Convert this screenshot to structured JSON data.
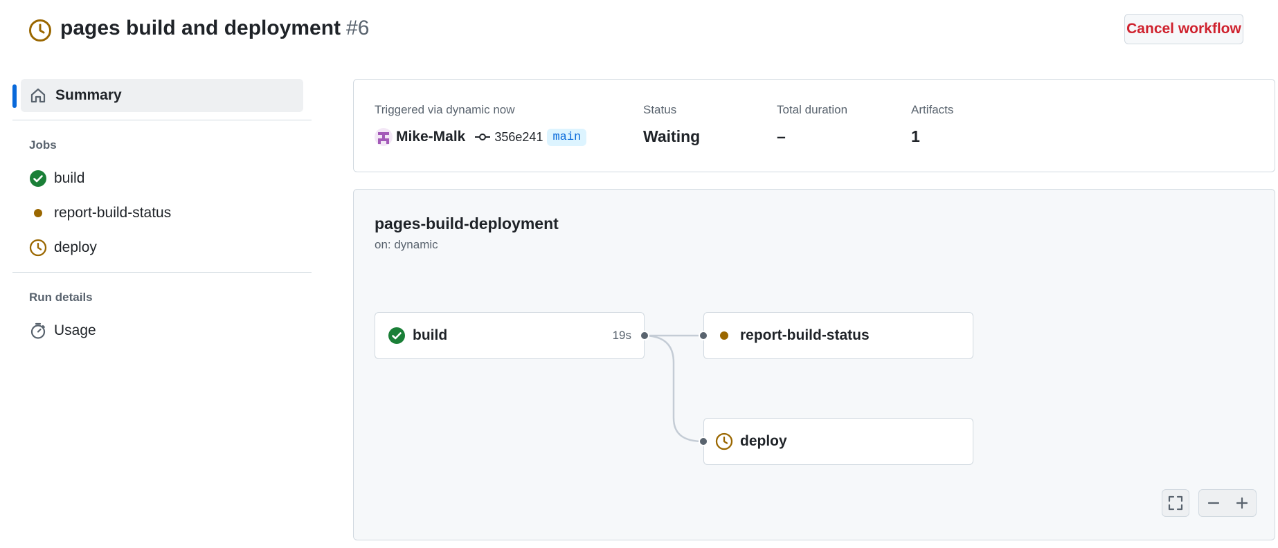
{
  "header": {
    "title": "pages build and deployment",
    "run_number": "#6",
    "status_icon": "clock-icon",
    "cancel_label": "Cancel workflow"
  },
  "sidebar": {
    "summary_label": "Summary",
    "jobs_heading": "Jobs",
    "jobs": [
      {
        "label": "build",
        "status": "success"
      },
      {
        "label": "report-build-status",
        "status": "in-progress"
      },
      {
        "label": "deploy",
        "status": "waiting"
      }
    ],
    "run_details_heading": "Run details",
    "usage_label": "Usage"
  },
  "summary": {
    "trigger_label": "Triggered via dynamic now",
    "actor": "Mike-Malk",
    "commit": "356e241",
    "branch": "main",
    "status_label": "Status",
    "status_value": "Waiting",
    "duration_label": "Total duration",
    "duration_value": "–",
    "artifacts_label": "Artifacts",
    "artifacts_value": "1"
  },
  "graph": {
    "workflow_name": "pages-build-deployment",
    "trigger": "on: dynamic",
    "jobs": [
      {
        "name": "build",
        "status": "success",
        "duration": "19s"
      },
      {
        "name": "report-build-status",
        "status": "in-progress"
      },
      {
        "name": "deploy",
        "status": "waiting"
      }
    ]
  },
  "colors": {
    "success": "#1a7f37",
    "waiting": "#9a6700",
    "accent": "#0969da",
    "danger": "#cf222e"
  }
}
